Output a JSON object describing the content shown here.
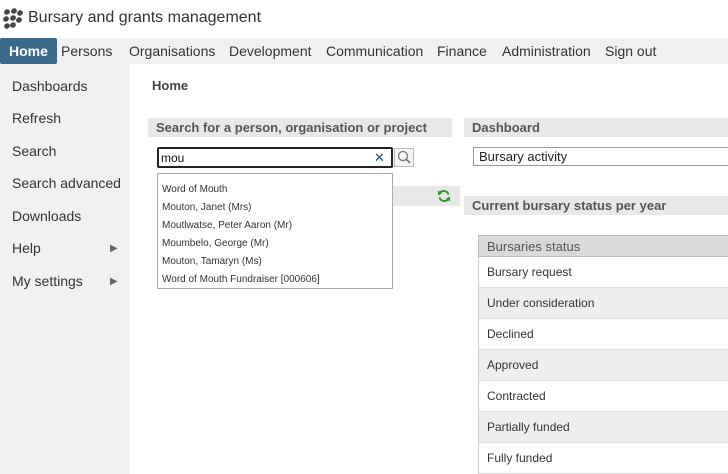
{
  "app": {
    "title": "Bursary and grants management"
  },
  "topnav": [
    {
      "label": "Home"
    },
    {
      "label": "Persons"
    },
    {
      "label": "Organisations"
    },
    {
      "label": "Development"
    },
    {
      "label": "Communication"
    },
    {
      "label": "Finance"
    },
    {
      "label": "Administration"
    },
    {
      "label": "Sign out"
    }
  ],
  "sidebar": {
    "items": [
      {
        "label": "Dashboards"
      },
      {
        "label": "Refresh"
      },
      {
        "label": "Search"
      },
      {
        "label": "Search advanced"
      },
      {
        "label": "Downloads"
      },
      {
        "label": "Help",
        "arrow": "▶"
      },
      {
        "label": "My settings",
        "arrow": "▶"
      }
    ]
  },
  "main": {
    "page_title": "Home",
    "search": {
      "heading": "Search for a person, organisation or project",
      "value": "mou",
      "clear": "✕",
      "suggestions": [
        "Word of Mouth",
        "Mouton, Janet (Mrs)",
        "Moutlwatse, Peter Aaron (Mr)",
        "Moumbelo, George (Mr)",
        "Mouton, Tamaryn (Ms)",
        "Word of Mouth Fundraiser [000606]"
      ]
    },
    "dashboard": {
      "heading": "Dashboard",
      "selected": "Bursary activity",
      "section_heading": "Current bursary status per year",
      "table": {
        "header": "Bursaries status",
        "rows": [
          "Bursary request",
          "Under consideration",
          "Declined",
          "Approved",
          "Contracted",
          "Partially funded",
          "Fully funded"
        ]
      }
    }
  },
  "icons": {
    "logo": "paw-logo-icon",
    "search": "magnifier-icon",
    "refresh": "refresh-icon"
  },
  "colors": {
    "nav_active": "#3b6a8b",
    "refresh": "#2a9d2a"
  }
}
